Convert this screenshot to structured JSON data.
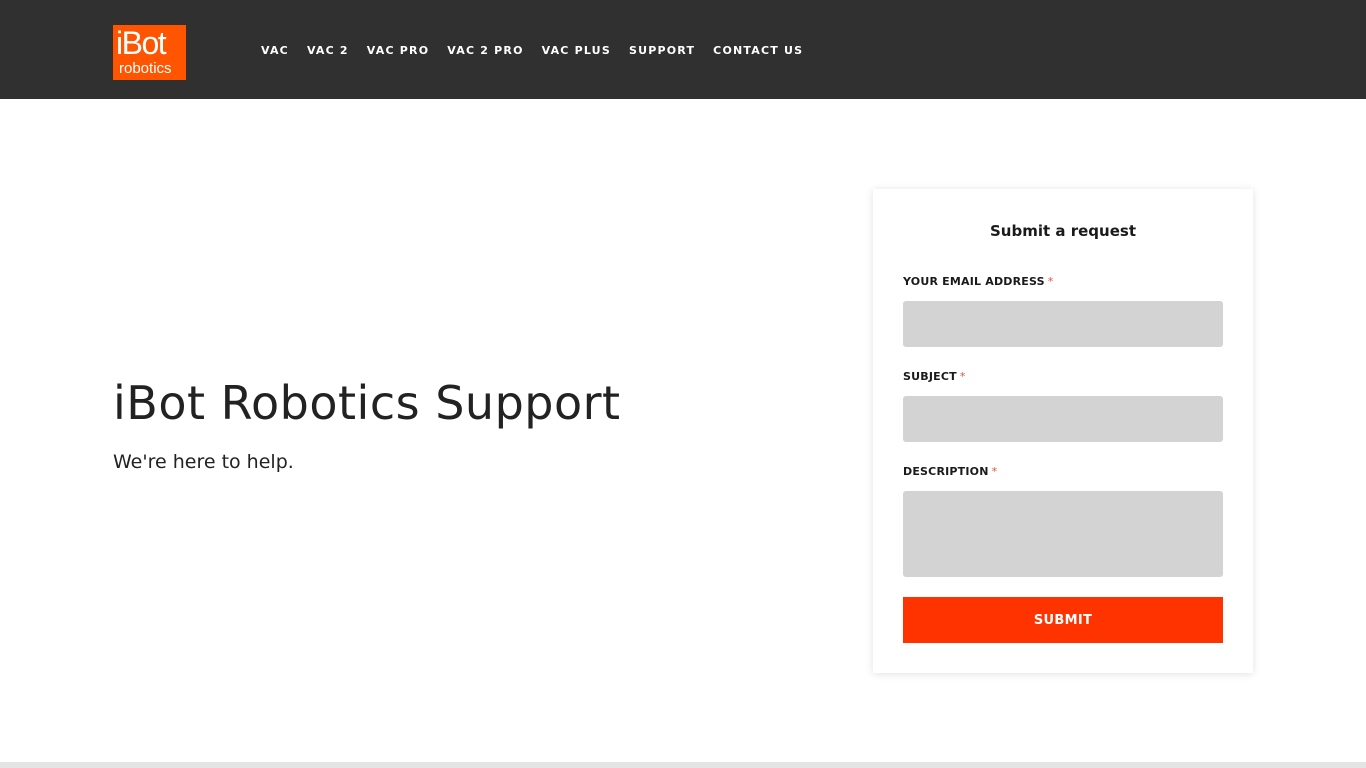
{
  "header": {
    "logo": {
      "line1": "iBot",
      "line2": "robotics"
    },
    "nav": [
      {
        "label": "VAC"
      },
      {
        "label": "VAC 2"
      },
      {
        "label": "VAC PRO"
      },
      {
        "label": "VAC 2 PRO"
      },
      {
        "label": "VAC PLUS"
      },
      {
        "label": "SUPPORT"
      },
      {
        "label": "CONTACT US"
      }
    ]
  },
  "hero": {
    "title": "iBot Robotics Support",
    "subtitle": "We're here to help."
  },
  "form": {
    "title": "Submit a request",
    "email_label": "YOUR EMAIL ADDRESS",
    "email_value": "",
    "subject_label": "SUBJECT",
    "subject_value": "",
    "description_label": "DESCRIPTION",
    "description_value": "",
    "required_marker": "*",
    "submit_label": "SUBMIT"
  },
  "colors": {
    "header_bg": "#303030",
    "logo_bg": "#ff5500",
    "accent": "#ff3300",
    "required": "#e0533b",
    "input_bg": "#d3d3d3"
  }
}
